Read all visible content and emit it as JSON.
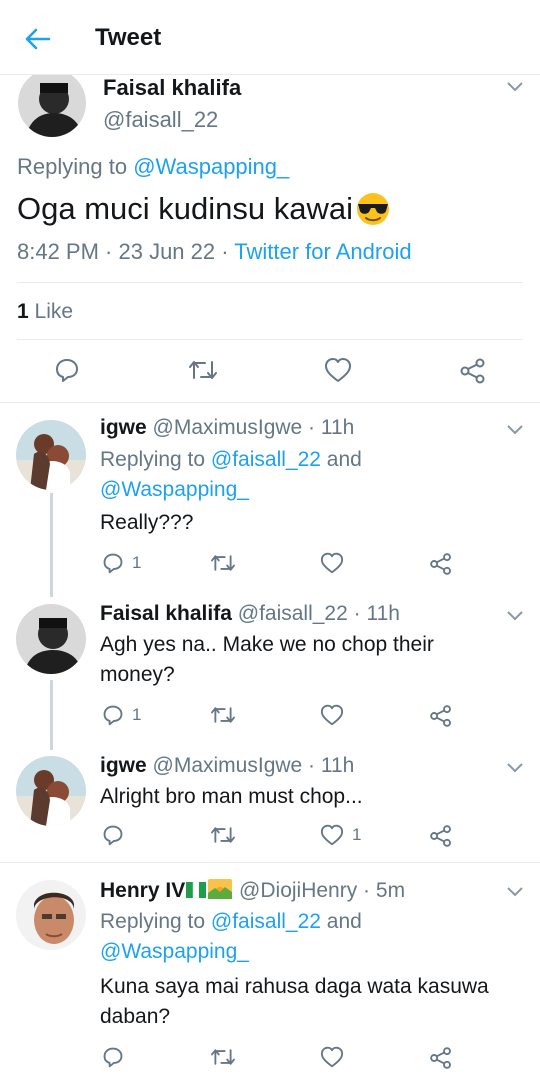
{
  "header": {
    "title": "Tweet"
  },
  "main_tweet": {
    "name": "Faisal khalifa",
    "handle": "@faisall_22",
    "replying_prefix": "Replying to",
    "replying_to": "@Waspapping_",
    "text": "Oga muci kudinsu kawai",
    "time": "8:42 PM · 23 Jun 22 ·",
    "source": "Twitter for Android",
    "likes_count": "1",
    "likes_label": "Like"
  },
  "replies": [
    {
      "name": "igwe",
      "handle": "@MaximusIgwe · 11h",
      "replying_prefix": "Replying to",
      "replying_to_1": "@faisall_22",
      "replying_and": "and",
      "replying_to_2": "@Waspapping_",
      "text": "Really???",
      "reply_count": "1",
      "like_count": ""
    },
    {
      "name": "Faisal khalifa",
      "handle": "@faisall_22 · 11h",
      "text_1": "Agh yes na.. Make we no chop their",
      "text_2": "money?",
      "reply_count": "1",
      "like_count": ""
    },
    {
      "name": "igwe",
      "handle": "@MaximusIgwe · 11h",
      "text": "Alright bro man must chop...",
      "reply_count": "",
      "like_count": "1"
    },
    {
      "name": "Henry IV",
      "handle": "@DiojiHenry · 5m",
      "replying_prefix": "Replying to",
      "replying_to_1": "@faisall_22",
      "replying_and": "and",
      "replying_to_2": "@Waspapping_",
      "text_1": "Kuna saya mai rahusa daga wata kasuwa",
      "text_2": "daban?",
      "reply_count": "",
      "like_count": ""
    }
  ],
  "colors": {
    "accent": "#1da1f2",
    "muted": "#657786",
    "divider": "#e6ecf0"
  }
}
